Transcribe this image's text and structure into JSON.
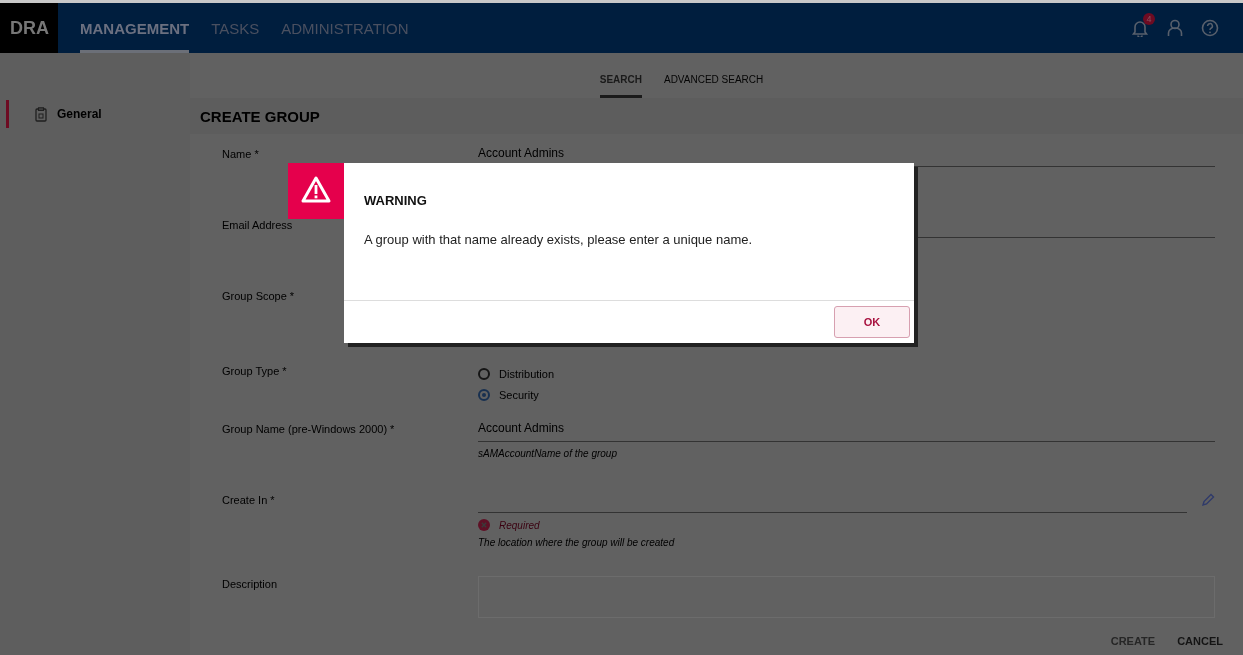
{
  "header": {
    "logo": "DRA",
    "nav": [
      {
        "label": "MANAGEMENT",
        "selected": true
      },
      {
        "label": "TASKS",
        "selected": false
      },
      {
        "label": "ADMINISTRATION",
        "selected": false
      }
    ],
    "notification_count": "4"
  },
  "subtabs": [
    {
      "label": "SEARCH",
      "selected": true
    },
    {
      "label": "ADVANCED SEARCH",
      "selected": false
    }
  ],
  "sidebar": {
    "items": [
      {
        "label": "General",
        "selected": true
      }
    ]
  },
  "form": {
    "title": "CREATE GROUP",
    "fields": [
      {
        "kind": "text",
        "label": "Name *",
        "value": "Account Admins"
      },
      {
        "kind": "text",
        "label": "Email Address"
      },
      {
        "kind": "blank",
        "label": "Group Scope *"
      },
      {
        "kind": "radio",
        "label": "Group Type *",
        "options": [
          {
            "label": "Distribution",
            "selected": false
          },
          {
            "label": "Security",
            "selected": true
          }
        ]
      },
      {
        "kind": "text",
        "label": "Group Name (pre-Windows 2000) *",
        "value": "Account Admins",
        "helper": "sAMAccountName of the group"
      },
      {
        "kind": "picker",
        "label": "Create In *",
        "error": "Required",
        "helper": "The location where the group will be created"
      },
      {
        "kind": "textarea",
        "label": "Description"
      }
    ]
  },
  "actions": [
    {
      "label": "CREATE",
      "disabled": true
    },
    {
      "label": "CANCEL",
      "disabled": false
    }
  ],
  "dialog": {
    "title": "WARNING",
    "message": "A group with that name already exists, please enter a unique name.",
    "button": "OK"
  }
}
